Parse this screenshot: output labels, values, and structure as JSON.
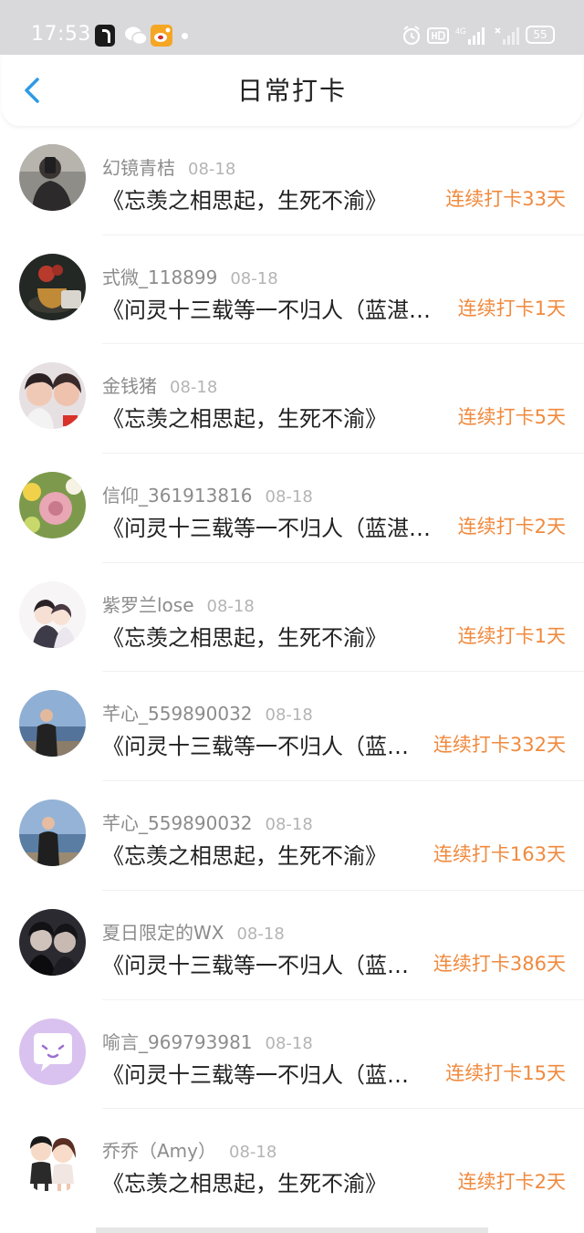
{
  "status_bar": {
    "time": "17:53",
    "icons": [
      "tiktok-icon",
      "wechat-icon",
      "weibo-icon",
      "notification-dot",
      "alarm-icon",
      "hd-icon",
      "4g-signal-icon",
      "signal-icon",
      "battery-icon"
    ],
    "battery": "55"
  },
  "nav": {
    "title": "日常打卡",
    "back_icon": "chevron-left-icon",
    "accent_color": "#2e9ae6"
  },
  "colors": {
    "streak": "#f08a3e",
    "username": "#8c8c8c",
    "date": "#b4b4b4",
    "title": "#222222"
  },
  "items": [
    {
      "username": "幻镜青桔",
      "date": "08-18",
      "title": "《忘羡之相思起，生死不渝》",
      "streak": "连续打卡33天"
    },
    {
      "username": "式微_118899",
      "date": "08-18",
      "title": "《问灵十三载等一不归人（蓝湛篇...",
      "streak": "连续打卡1天"
    },
    {
      "username": "金钱猪",
      "date": "08-18",
      "title": "《忘羡之相思起，生死不渝》",
      "streak": "连续打卡5天"
    },
    {
      "username": "信仰_361913816",
      "date": "08-18",
      "title": "《问灵十三载等一不归人（蓝湛篇...",
      "streak": "连续打卡2天"
    },
    {
      "username": "紫罗兰lose",
      "date": "08-18",
      "title": "《忘羡之相思起，生死不渝》",
      "streak": "连续打卡1天"
    },
    {
      "username": "芊心_559890032",
      "date": "08-18",
      "title": "《问灵十三载等一不归人（蓝湛...",
      "streak": "连续打卡332天"
    },
    {
      "username": "芊心_559890032",
      "date": "08-18",
      "title": "《忘羡之相思起，生死不渝》",
      "streak": "连续打卡163天"
    },
    {
      "username": "夏日限定的WX",
      "date": "08-18",
      "title": "《问灵十三载等一不归人（蓝湛...",
      "streak": "连续打卡386天"
    },
    {
      "username": "喻言_969793981",
      "date": "08-18",
      "title": "《问灵十三载等一不归人（蓝湛...",
      "streak": "连续打卡15天"
    },
    {
      "username": "乔乔（Amy）",
      "date": "08-18",
      "title": "《忘羡之相思起，生死不渝》",
      "streak": "连续打卡2天"
    }
  ]
}
